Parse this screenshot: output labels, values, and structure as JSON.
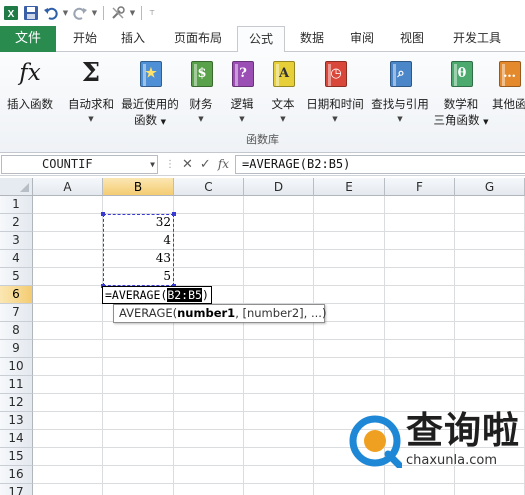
{
  "quick_access": {
    "icons": [
      "save-icon",
      "undo-icon",
      "redo-icon",
      "customize-icon"
    ]
  },
  "tabs": [
    {
      "label": "文件",
      "active": false
    },
    {
      "label": "开始",
      "active": false
    },
    {
      "label": "插入",
      "active": false
    },
    {
      "label": "页面布局",
      "active": false
    },
    {
      "label": "公式",
      "active": true
    },
    {
      "label": "数据",
      "active": false
    },
    {
      "label": "审阅",
      "active": false
    },
    {
      "label": "视图",
      "active": false
    },
    {
      "label": "开发工具",
      "active": false
    }
  ],
  "ribbon": {
    "buttons": [
      {
        "line1": "插入函数",
        "line2": "",
        "icon": "insert-function-icon",
        "glyph": "fx"
      },
      {
        "line1": "自动求和",
        "line2": "",
        "icon": "autosum-icon",
        "glyph": "Σ"
      },
      {
        "line1": "最近使用的",
        "line2": "函数",
        "icon": "recently-used-icon",
        "glyph": "★"
      },
      {
        "line1": "财务",
        "line2": "",
        "icon": "financial-icon",
        "glyph": "$"
      },
      {
        "line1": "逻辑",
        "line2": "",
        "icon": "logical-icon",
        "glyph": "?"
      },
      {
        "line1": "文本",
        "line2": "",
        "icon": "text-icon",
        "glyph": "A"
      },
      {
        "line1": "日期和时间",
        "line2": "",
        "icon": "date-time-icon",
        "glyph": "◷"
      },
      {
        "line1": "查找与引用",
        "line2": "",
        "icon": "lookup-reference-icon",
        "glyph": "⌕"
      },
      {
        "line1": "数学和",
        "line2": "三角函数",
        "icon": "math-trig-icon",
        "glyph": "θ"
      },
      {
        "line1": "其他函",
        "line2": "",
        "icon": "more-functions-icon",
        "glyph": "…"
      }
    ],
    "group_label": "函数库"
  },
  "formula_bar": {
    "name_box": "COUNTIF",
    "cancel_symbol": "✕",
    "enter_symbol": "✓",
    "fx_symbol": "fx",
    "formula": "=AVERAGE(B2:B5)"
  },
  "sheet": {
    "columns": [
      "A",
      "B",
      "C",
      "D",
      "E",
      "F",
      "G"
    ],
    "rows": [
      "1",
      "2",
      "3",
      "4",
      "5",
      "6",
      "7",
      "8",
      "9",
      "10",
      "11",
      "12",
      "13",
      "14",
      "15",
      "16",
      "17"
    ],
    "values": [
      {
        "row": "2",
        "text": "32"
      },
      {
        "row": "3",
        "text": "4"
      },
      {
        "row": "4",
        "text": "43"
      },
      {
        "row": "5",
        "text": "5"
      }
    ],
    "edit_cell": {
      "prefix": "=AVERAGE",
      "paren_open": "(",
      "reference": "B2:B5",
      "paren_close": ")"
    },
    "tooltip": {
      "func": "AVERAGE(",
      "arg1": "number1",
      "rest": ", [number2], ...)"
    }
  },
  "watermark": {
    "brand": "查询啦",
    "url": "chaxunla.com"
  },
  "colors": {
    "file_tab": "#2a8b4f",
    "marquee": "#3a3ad0",
    "selected_header": "#f4cc72",
    "watermark_blue": "#1e88d6"
  }
}
